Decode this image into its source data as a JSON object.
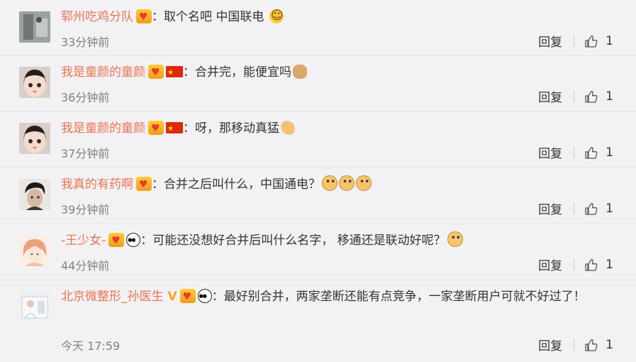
{
  "comments": [
    {
      "name": "郓州吃鸡分队",
      "text": "取个名吧 中国联电",
      "time": "33分钟前",
      "reply": "回复",
      "likes": "1"
    },
    {
      "name": "我是童颜的童颜",
      "text": "合并完，能便宜吗",
      "time": "36分钟前",
      "reply": "回复",
      "likes": "1"
    },
    {
      "name": "我是童颜的童颜",
      "text": "呀，那移动真猛",
      "time": "37分钟前",
      "reply": "回复",
      "likes": "1"
    },
    {
      "name": "我真的有药啊",
      "text": "合并之后叫什么，中国通电？",
      "time": "39分钟前",
      "reply": "回复",
      "likes": "1"
    },
    {
      "name": "-王少女-",
      "text": "可能还没想好合并后叫什么名字， 移通还是联动好呢？",
      "time": "44分钟前",
      "reply": "回复",
      "likes": "1"
    },
    {
      "name": "北京微整形_孙医生",
      "text": "最好别合并，两家垄断还能有点竞争，一家垄断用户可就不好过了！",
      "time": "今天 17:59",
      "reply": "回复",
      "likes": "1"
    }
  ],
  "separator": "：",
  "colors": {
    "username": "#eb7350",
    "time": "#808080",
    "background": "#f2f2f5"
  }
}
